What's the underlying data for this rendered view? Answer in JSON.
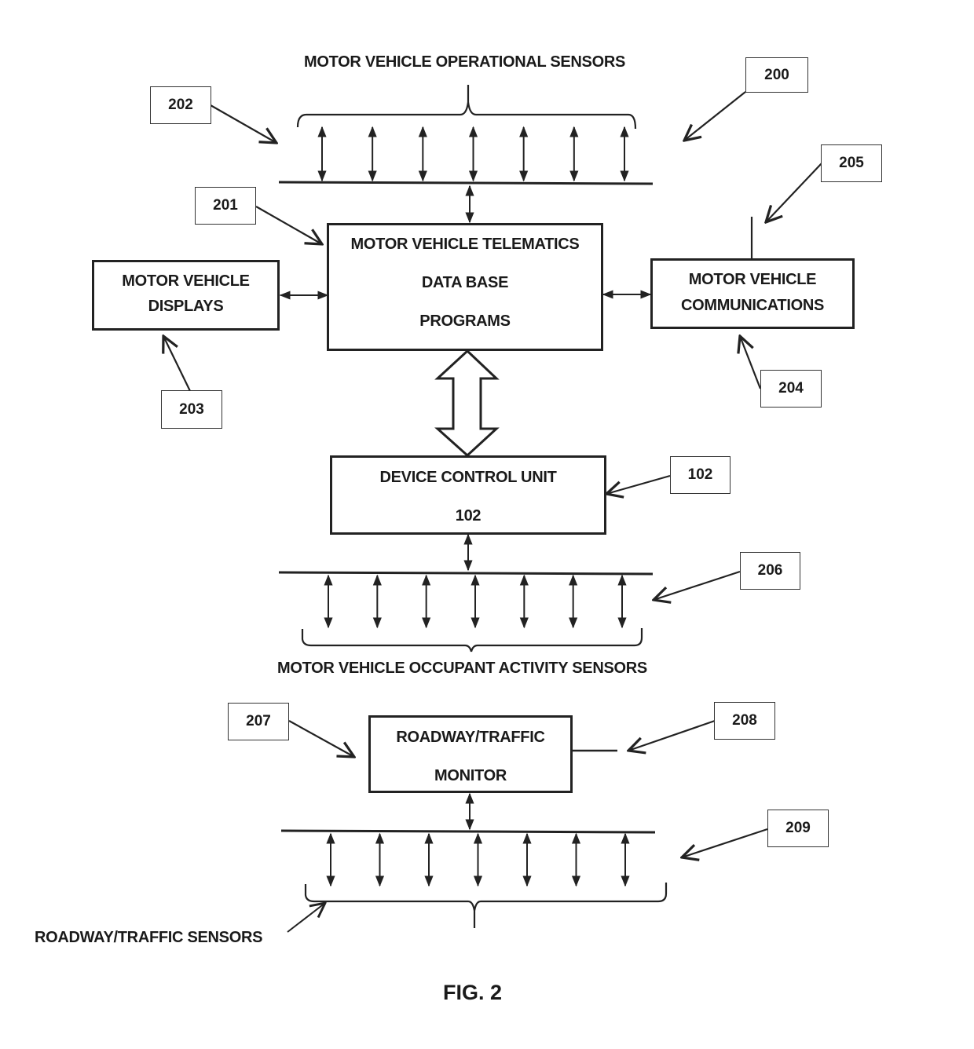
{
  "figure_label": "FIG. 2",
  "groups": {
    "operational_sensors": {
      "title": "MOTOR VEHICLE OPERATIONAL SENSORS",
      "sensor_count": 7
    },
    "occupant_sensors": {
      "title": "MOTOR VEHICLE OCCUPANT ACTIVITY SENSORS",
      "sensor_count": 7
    },
    "roadway_sensors": {
      "title": "ROADWAY/TRAFFIC SENSORS",
      "sensor_count": 7
    }
  },
  "blocks": {
    "telematics": {
      "lines": [
        "MOTOR VEHICLE TELEMATICS",
        "DATA BASE",
        "PROGRAMS"
      ]
    },
    "displays": {
      "lines": [
        "MOTOR VEHICLE",
        "DISPLAYS"
      ]
    },
    "communications": {
      "lines": [
        "MOTOR VEHICLE",
        "COMMUNICATIONS"
      ]
    },
    "device_control_unit": {
      "lines": [
        "DEVICE CONTROL UNIT",
        "102"
      ]
    },
    "roadway_monitor": {
      "lines": [
        "ROADWAY/TRAFFIC",
        "MONITOR"
      ]
    }
  },
  "reference_numerals": {
    "r200": "200",
    "r201": "201",
    "r202": "202",
    "r203": "203",
    "r204": "204",
    "r205": "205",
    "r102": "102",
    "r206": "206",
    "r207": "207",
    "r208": "208",
    "r209": "209"
  },
  "connections": [
    {
      "from": "operational_sensors",
      "to": "telematics",
      "type": "bidirectional"
    },
    {
      "from": "displays",
      "to": "telematics",
      "type": "bidirectional"
    },
    {
      "from": "telematics",
      "to": "communications",
      "type": "bidirectional"
    },
    {
      "from": "telematics",
      "to": "device_control_unit",
      "type": "bidirectional-wide"
    },
    {
      "from": "device_control_unit",
      "to": "occupant_sensors",
      "type": "bidirectional"
    },
    {
      "from": "roadway_monitor",
      "to": "roadway_sensors",
      "type": "bidirectional"
    }
  ]
}
